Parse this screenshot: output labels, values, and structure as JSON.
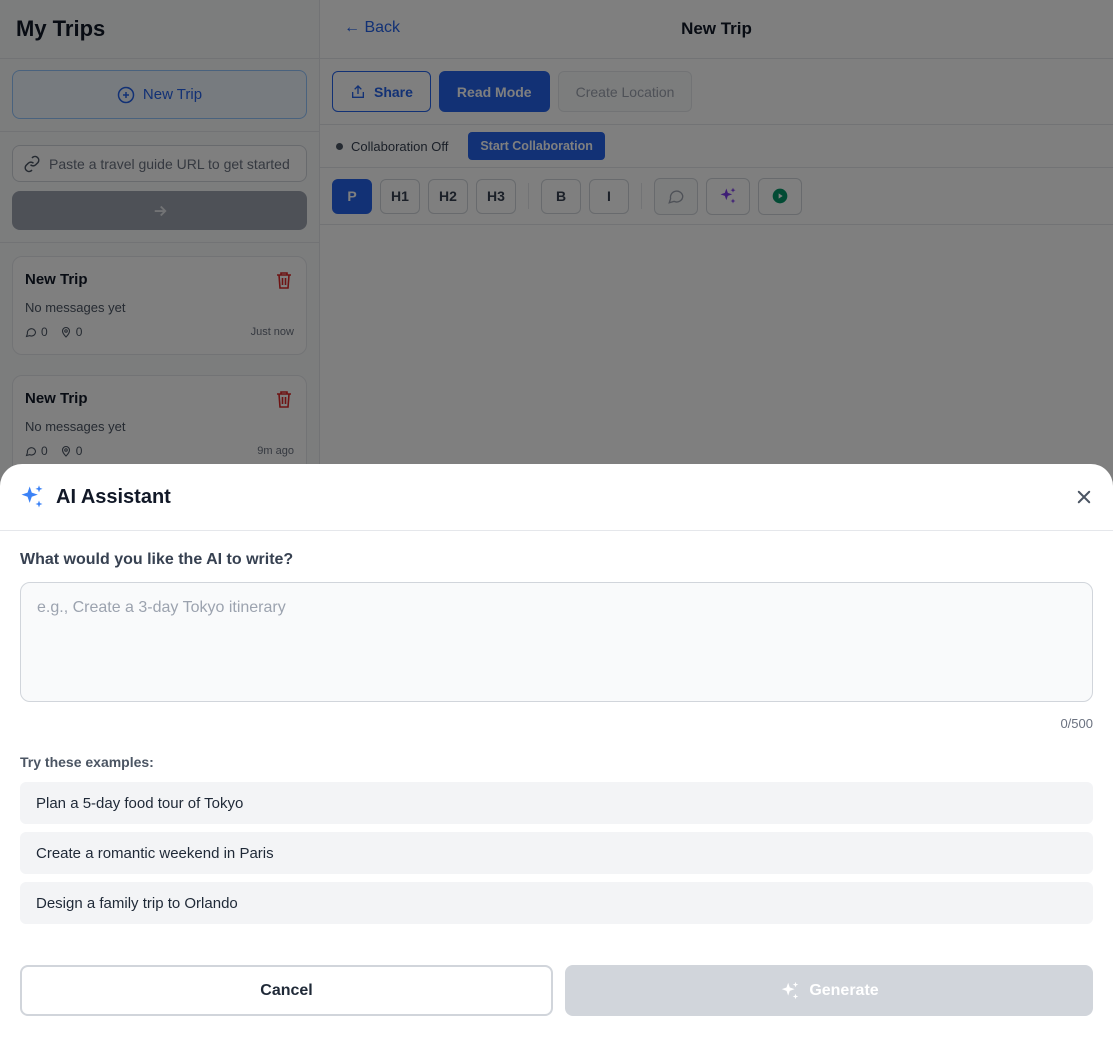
{
  "sidebar": {
    "title": "My Trips",
    "new_trip_label": "New Trip",
    "url_placeholder": "Paste a travel guide URL to get started",
    "trips": [
      {
        "title": "New Trip",
        "preview": "No messages yet",
        "messages": "0",
        "locations": "0",
        "time": "Just now"
      },
      {
        "title": "New Trip",
        "preview": "No messages yet",
        "messages": "0",
        "locations": "0",
        "time": "9m ago"
      }
    ]
  },
  "header": {
    "back_label": "Back",
    "title": "New Trip"
  },
  "actions": {
    "share_label": "Share",
    "read_mode_label": "Read Mode",
    "create_location_label": "Create Location"
  },
  "collaboration": {
    "status": "Collaboration Off",
    "start_label": "Start Collaboration"
  },
  "format_toolbar": {
    "paragraph": "P",
    "h1": "H1",
    "h2": "H2",
    "h3": "H3",
    "bold": "B",
    "italic": "I"
  },
  "ai_modal": {
    "title": "AI Assistant",
    "question": "What would you like the AI to write?",
    "placeholder": "e.g., Create a 3-day Tokyo itinerary",
    "value": "",
    "char_count": "0/500",
    "examples_label": "Try these examples:",
    "examples": [
      "Plan a 5-day food tour of Tokyo",
      "Create a romantic weekend in Paris",
      "Design a family trip to Orlando"
    ],
    "cancel_label": "Cancel",
    "generate_label": "Generate"
  },
  "colors": {
    "accent": "#2563eb",
    "danger": "#dc2626",
    "ai_purple": "#7c3aed",
    "play_green": "#059669",
    "disabled": "#d1d5db"
  }
}
